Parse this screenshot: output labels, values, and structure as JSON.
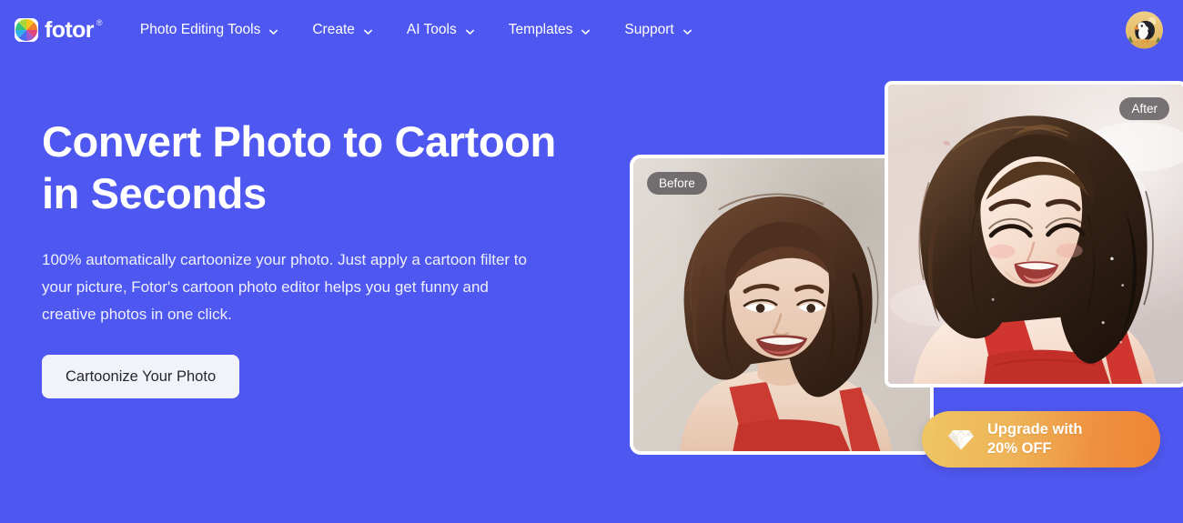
{
  "brand": {
    "name": "fotor",
    "registered_mark": "®",
    "logo_icon": "fotor-color-wheel-icon"
  },
  "nav": {
    "items": [
      {
        "label": "Photo Editing Tools",
        "icon": "chevron-down-icon"
      },
      {
        "label": "Create",
        "icon": "chevron-down-icon"
      },
      {
        "label": "AI Tools",
        "icon": "chevron-down-icon"
      },
      {
        "label": "Templates",
        "icon": "chevron-down-icon"
      },
      {
        "label": "Support",
        "icon": "chevron-down-icon"
      }
    ]
  },
  "account": {
    "avatar_icon": "puffin-bird-avatar"
  },
  "hero": {
    "title": "Convert Photo to Cartoon in Seconds",
    "subtitle": "100% automatically cartoonize your photo. Just apply a cartoon filter to your picture, Fotor's cartoon photo editor helps you get funny and creative photos in one click.",
    "cta_label": "Cartoonize Your Photo"
  },
  "comparison": {
    "before": {
      "badge": "Before",
      "description": "Photograph of a smiling woman with wavy brown hair wearing a red top against a light grey wall"
    },
    "after": {
      "badge": "After",
      "description": "Anime-style cartoon illustration of the same woman with closed smiling eyes, dark flowing hair and red top against a soft pink cloudy sky"
    }
  },
  "upgrade": {
    "line1": "Upgrade with",
    "line2": "20% OFF",
    "icon": "diamond-gem-icon"
  },
  "colors": {
    "background": "#4e57f0",
    "cta_background": "#f2f3fa",
    "cta_text": "#26272d",
    "upgrade_gradient_start": "#efc663",
    "upgrade_gradient_end": "#ef8433",
    "badge_background": "rgba(70,68,72,0.72)",
    "text_primary": "#ffffff"
  }
}
